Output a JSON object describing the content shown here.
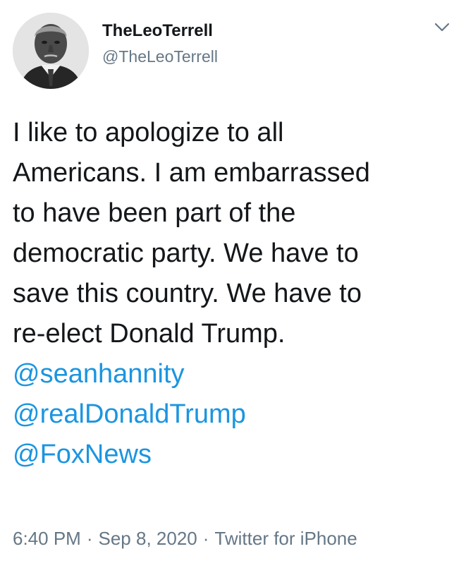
{
  "tweet": {
    "author": {
      "display_name": "TheLeoTerrell",
      "handle": "@TheLeoTerrell",
      "avatar_icon": "person-avatar-icon"
    },
    "menu_icon": "chevron-down-icon",
    "text_lines": [
      "I like to apologize to all",
      "Americans. I am embarrassed",
      "to have been part of the",
      "democratic party. We have to",
      "save this country. We have to",
      "re-elect Donald Trump."
    ],
    "mentions": [
      "@seanhannity",
      "@realDonaldTrump",
      "@FoxNews"
    ],
    "meta": {
      "time": "6:40 PM",
      "separator": "·",
      "date": "Sep 8, 2020",
      "source": "Twitter for iPhone"
    }
  },
  "colors": {
    "text": "#14171a",
    "secondary": "#657786",
    "link": "#1b95e0",
    "background": "#ffffff"
  }
}
